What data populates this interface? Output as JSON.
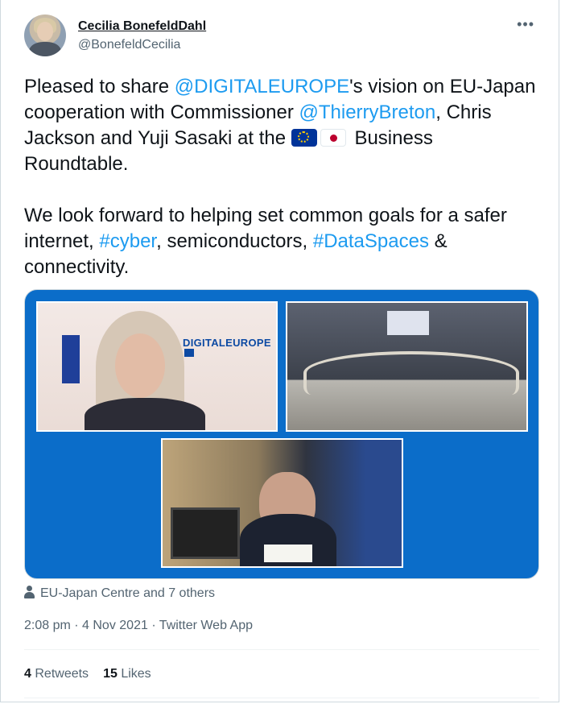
{
  "author": {
    "name": "Cecilia BonefeldDahl",
    "handle": "@BonefeldCecilia"
  },
  "menu": {
    "more_icon": "•••"
  },
  "tweet": {
    "p1_a": "Pleased to share ",
    "p1_link1": "@DIGITALEUROPE",
    "p1_b": "'s vision on EU-Japan cooperation with Commissioner ",
    "p1_link2": "@ThierryBreton",
    "p1_c": ", Chris Jackson and Yuji Sasaki at the ",
    "p1_d": " Business Roundtable.",
    "p2_a": "We look forward to helping set common goals for a safer internet, ",
    "p2_link1": "#cyber",
    "p2_b": ", semiconductors, ",
    "p2_link2": "#DataSpaces",
    "p2_c": " & connectivity."
  },
  "media": {
    "logo_text": "DIGITALEUROPE",
    "colors": {
      "background": "#0b6dc9"
    }
  },
  "liked_by": "EU-Japan Centre and 7 others",
  "meta": "2:08 pm · 4 Nov 2021 · Twitter Web App",
  "stats": {
    "retweets_count": "4",
    "retweets_label": "Retweets",
    "likes_count": "15",
    "likes_label": "Likes"
  },
  "colors": {
    "link": "#1d9bf0",
    "secondary_text": "#536471",
    "text": "#0f1419"
  }
}
